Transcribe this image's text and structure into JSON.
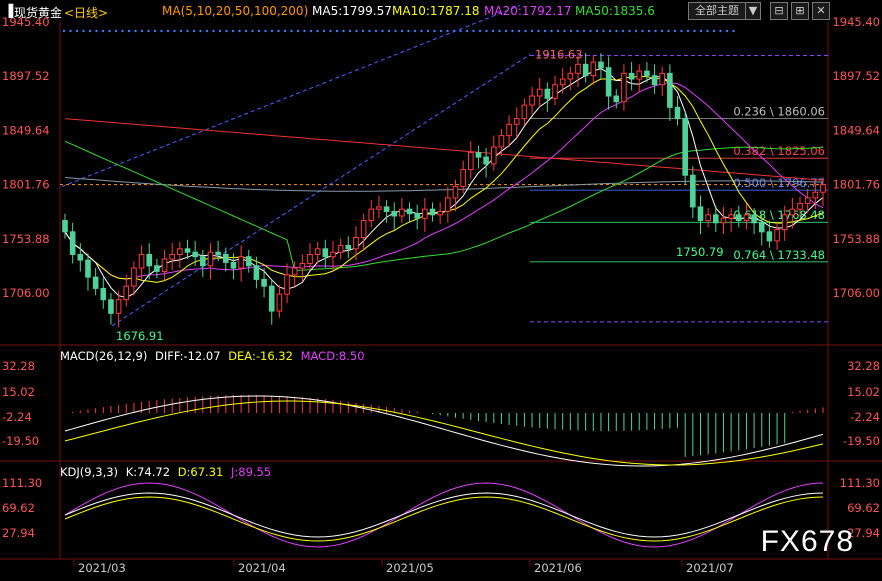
{
  "header": {
    "symbol": "现货黄金",
    "period": "<日线>",
    "ma_label": "MA(5,10,20,50,100,200)",
    "ma5": "MA5:1799.57",
    "ma10": "MA10:1787.18",
    "ma20": "MA20:1792.17",
    "ma50": "MA50:1835.6",
    "theme_button": "全部主题",
    "theme_arrow": "▼"
  },
  "macd_header": {
    "label": "MACD(26,12,9)",
    "diff": "DIFF:-12.07",
    "dea": "DEA:-16.32",
    "macd": "MACD:8.50"
  },
  "kdj_header": {
    "label": "KDJ(9,3,3)",
    "k": "K:74.72",
    "d": "D:67.31",
    "j": "J:89.55"
  },
  "watermark": "FX678",
  "colors": {
    "up": "#ff3b3b",
    "down": "#4fd39a",
    "ma5": "#ffffff",
    "ma10": "#ffff00",
    "ma20": "#e040fb",
    "ma50": "#33dd33",
    "ma100": "#8899aa",
    "ma200": "#ee3333"
  },
  "chart_data": [
    {
      "type": "candlestick",
      "title": "现货黄金 日线",
      "x_labels": [
        "2021/03",
        "2021/04",
        "2021/05",
        "2021/06",
        "2021/07"
      ],
      "y_ticks": [
        1945.4,
        1897.52,
        1849.64,
        1801.76,
        1753.88,
        1706.0
      ],
      "ylim": [
        1660,
        1945.4
      ],
      "current_price": 1801.76,
      "annotations": [
        {
          "text": "1916.63",
          "value": 1916.63
        },
        {
          "text": "1676.91",
          "value": 1676.91
        },
        {
          "text": "1750.79",
          "value": 1750.79
        }
      ],
      "fibonacci": [
        {
          "text": "0.236 \\ 1860.06",
          "value": 1860.06
        },
        {
          "text": "0.382 \\ 1825.06",
          "value": 1825.06
        },
        {
          "text": "0.500 \\ 1796.77",
          "value": 1796.77
        },
        {
          "text": "0.618 \\ 1768.48",
          "value": 1768.48
        },
        {
          "text": "0.764 \\ 1733.48",
          "value": 1733.48
        }
      ],
      "closes": [
        1760,
        1740,
        1735,
        1720,
        1710,
        1700,
        1688,
        1700,
        1712,
        1728,
        1740,
        1730,
        1725,
        1736,
        1740,
        1745,
        1742,
        1738,
        1730,
        1742,
        1740,
        1733,
        1728,
        1738,
        1730,
        1718,
        1712,
        1690,
        1705,
        1722,
        1728,
        1732,
        1740,
        1745,
        1738,
        1742,
        1748,
        1745,
        1755,
        1770,
        1780,
        1782,
        1778,
        1774,
        1780,
        1776,
        1772,
        1780,
        1775,
        1778,
        1790,
        1800,
        1815,
        1830,
        1826,
        1820,
        1835,
        1845,
        1855,
        1860,
        1872,
        1880,
        1886,
        1878,
        1890,
        1895,
        1900,
        1908,
        1898,
        1910,
        1905,
        1880,
        1875,
        1900,
        1895,
        1902,
        1898,
        1890,
        1900,
        1870,
        1860,
        1810,
        1782,
        1770,
        1775,
        1768,
        1772,
        1775,
        1770,
        1775,
        1768,
        1760,
        1752,
        1762,
        1775,
        1780,
        1785,
        1790,
        1795,
        1801.76
      ],
      "ma_series": [
        "MA5",
        "MA10",
        "MA20",
        "MA50",
        "MA100",
        "MA200"
      ]
    },
    {
      "type": "macd",
      "title": "MACD(26,12,9)",
      "y_ticks": [
        32.28,
        15.02,
        -2.24,
        -19.5
      ],
      "diff": -12.07,
      "dea": -16.32,
      "macd": 8.5
    },
    {
      "type": "kdj",
      "title": "KDJ(9,3,3)",
      "y_ticks": [
        111.3,
        69.62,
        27.94
      ],
      "k": 74.72,
      "d": 67.31,
      "j": 89.55
    }
  ]
}
